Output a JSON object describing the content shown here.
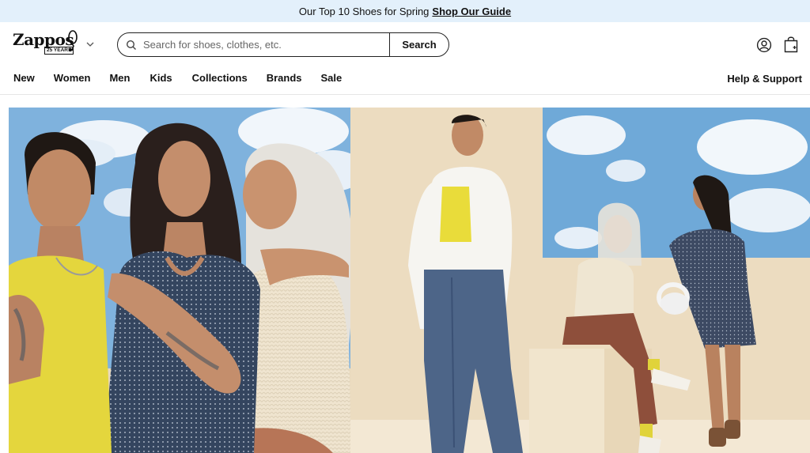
{
  "promo": {
    "text": "Our Top 10 Shoes for Spring",
    "link": "Shop Our Guide"
  },
  "header": {
    "logo_text": "Zappos",
    "logo_badge": "25 YEARS",
    "search_placeholder": "Search for shoes, clothes, etc.",
    "search_button": "Search"
  },
  "nav": {
    "items": [
      "New",
      "Women",
      "Men",
      "Kids",
      "Collections",
      "Brands",
      "Sale"
    ],
    "help": "Help & Support"
  },
  "icons": {
    "logo_menu": "chevron-down-icon",
    "search": "search-icon",
    "account": "user-icon",
    "cart": "shopping-bag-icon"
  },
  "colors": {
    "promo_bg": "#e3f0fb",
    "sky": "#6fa9d8",
    "backdrop": "#ecdcc0",
    "yellow_top": "#e9dc3a",
    "polka_dress": "#34455f",
    "denim": "#4d6588"
  }
}
